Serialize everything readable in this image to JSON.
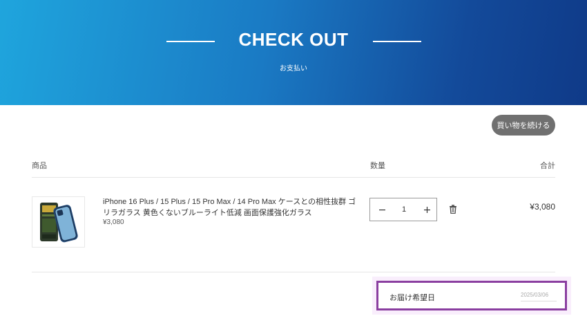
{
  "hero": {
    "title": "CHECK OUT",
    "subtitle": "お支払い"
  },
  "actions": {
    "continue_shopping": "買い物を続ける"
  },
  "cart": {
    "headers": {
      "product": "商品",
      "quantity": "数量",
      "total": "合計"
    },
    "items": [
      {
        "name": "iPhone 16 Plus / 15 Plus / 15 Pro Max / 14 Pro Max ケースとの相性抜群 ゴリラガラス 黄色くないブルーライト低減 画面保護強化ガラス",
        "price": "¥3,080",
        "quantity": "1",
        "line_total": "¥3,080",
        "icons": {
          "minus": "minus-icon",
          "plus": "plus-icon",
          "remove": "trash-icon"
        }
      }
    ]
  },
  "delivery": {
    "label": "お届け希望日",
    "date": "2025/03/06"
  },
  "colors": {
    "gradient_start": "#1fa5dd",
    "gradient_end": "#0f3a88",
    "button_gray": "#707070",
    "highlight_border": "#8a3ea0"
  }
}
